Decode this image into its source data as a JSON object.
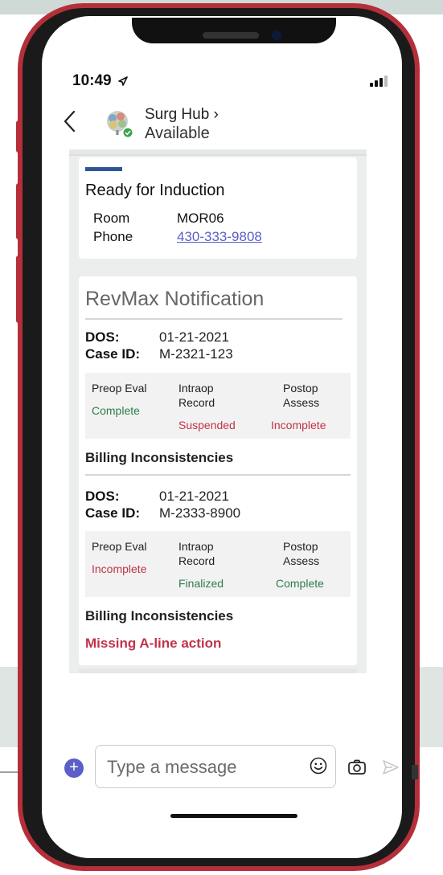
{
  "status_bar": {
    "time": "10:49"
  },
  "header": {
    "title": "Surg Hub ›",
    "presence": "Available"
  },
  "card_ready": {
    "title": "Ready for Induction",
    "room_label": "Room",
    "room_value": "MOR06",
    "phone_label": "Phone",
    "phone_value": "430-333-9808"
  },
  "revmax": {
    "title": "RevMax Notification",
    "cases": [
      {
        "dos_label": "DOS:",
        "dos_value": "01-21-2021",
        "case_label": "Case ID:",
        "case_value": "M-2321-123",
        "preop_label": "Preop Eval",
        "preop_status": "Complete",
        "intraop_label_1": "Intraop",
        "intraop_label_2": "Record",
        "intraop_status": "Suspended",
        "postop_label_1": "Postop",
        "postop_label_2": "Assess",
        "postop_status": "Incomplete",
        "billing_title": "Billing Inconsistencies"
      },
      {
        "dos_label": "DOS:",
        "dos_value": "01-21-2021",
        "case_label": "Case ID:",
        "case_value": "M-2333-8900",
        "preop_label": "Preop Eval",
        "preop_status": "Incomplete",
        "intraop_label_1": "Intraop",
        "intraop_label_2": "Record",
        "intraop_status": "Finalized",
        "postop_label_1": "Postop",
        "postop_label_2": "Assess",
        "postop_status": "Complete",
        "billing_title": "Billing Inconsistencies",
        "billing_item": "Missing A-line action"
      }
    ]
  },
  "compose": {
    "placeholder": "Type a message",
    "plus_symbol": "+"
  },
  "colors": {
    "accent": "#2f5597",
    "complete": "#2e7d4a",
    "incomplete": "#c0334a",
    "teams_purple": "#5b5fc7",
    "frame": "#b42f3a"
  }
}
